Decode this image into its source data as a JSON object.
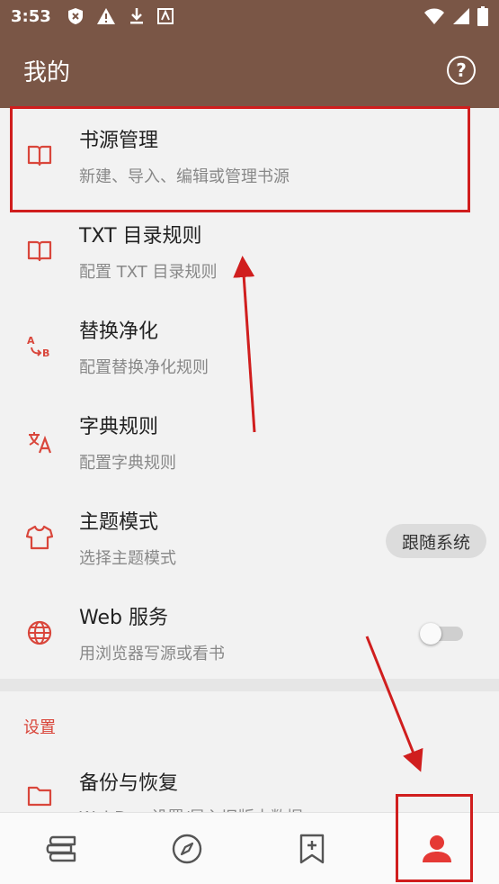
{
  "status": {
    "time": "3:53"
  },
  "appbar": {
    "title": "我的",
    "help_icon": "help-circle-icon"
  },
  "items": [
    {
      "title": "书源管理",
      "subtitle": "新建、导入、编辑或管理书源",
      "icon": "book-open-icon"
    },
    {
      "title": "TXT 目录规则",
      "subtitle": "配置 TXT 目录规则",
      "icon": "book-open-icon"
    },
    {
      "title": "替换净化",
      "subtitle": "配置替换净化规则",
      "icon": "replace-ab-icon"
    },
    {
      "title": "字典规则",
      "subtitle": "配置字典规则",
      "icon": "translate-icon"
    },
    {
      "title": "主题模式",
      "subtitle": "选择主题模式",
      "icon": "shirt-icon",
      "control": "跟随系统"
    },
    {
      "title": "Web 服务",
      "subtitle": "用浏览器写源或看书",
      "icon": "globe-icon",
      "toggle": false
    }
  ],
  "settings": {
    "section_label": "设置",
    "backup": {
      "title": "备份与恢复",
      "subtitle": "WebDav 设置/导入旧版本数据",
      "icon": "folder-icon"
    }
  },
  "bottom_nav": [
    "bookshelf-icon",
    "compass-icon",
    "bookmark-add-icon",
    "person-icon"
  ],
  "colors": {
    "primary": "#7a5646",
    "accent": "#d9463b",
    "annotation": "#d01e1e"
  }
}
